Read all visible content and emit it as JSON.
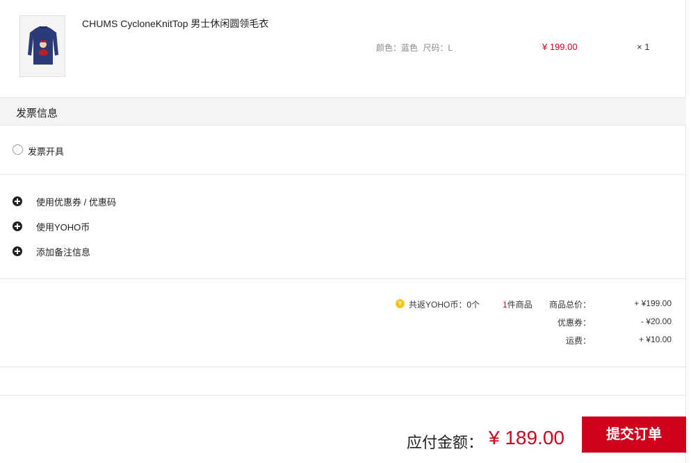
{
  "product": {
    "name": "CHUMS CycloneKnitTop 男士休闲圆领毛衣",
    "color": "颜色：蓝色",
    "size": "尺码：L",
    "price": "¥ 199.00",
    "quantity": "× 1",
    "thumbnail_icon": "sweater-thumbnail",
    "colors": {
      "sweater": "#2b3a78",
      "accent": "#b3202a"
    }
  },
  "invoice": {
    "section_title": "发票信息",
    "option_label": "发票开具"
  },
  "options": {
    "coupon": "使用优惠券 / 优惠码",
    "yoho_coin": "使用YOHO币",
    "remark": "添加备注信息"
  },
  "summary": {
    "coin_icon": "Y",
    "coin_text": "共返YOHO币：0个",
    "item_count_num": "1",
    "item_count_suffix": "件商品",
    "total_label": "商品总价：",
    "total_value": "+ ¥199.00",
    "coupon_label": "优惠券：",
    "coupon_value": "- ¥20.00",
    "shipping_label": "运费：",
    "shipping_value": "+ ¥10.00"
  },
  "footer": {
    "pay_label": "应付金额：",
    "pay_amount": "¥ 189.00",
    "submit_label": "提交订单"
  },
  "colors": {
    "accent_red": "#d0021b",
    "section_bg": "#f4f4f4"
  }
}
